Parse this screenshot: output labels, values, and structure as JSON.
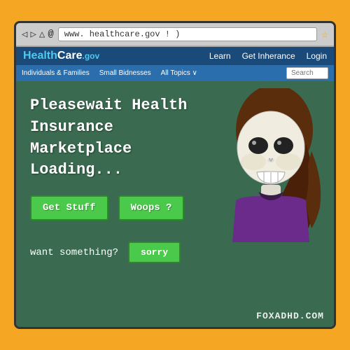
{
  "browser": {
    "address": "www. healthcare.gov ! )",
    "nav_back": "◁",
    "nav_forward": "▷",
    "nav_up": "△",
    "nav_refresh": "@",
    "bookmark": "☆"
  },
  "site": {
    "logo_health": "Health",
    "logo_care": "Care",
    "logo_gov": ".gov",
    "nav_items": [
      "Learn",
      "Get Inherance",
      "Login"
    ],
    "sub_nav_items": [
      "Individuals & Families",
      "Small Bidnesses",
      "All Topics ∨"
    ],
    "search_placeholder": "Search"
  },
  "main": {
    "loading_text": "Pleasewait Health Insurance Marketplace Loading...",
    "btn_get_stuff": "Get Stuff",
    "btn_woops": "Woops ?",
    "want_text": "want something?",
    "sorry_btn": "sorry",
    "watermark": "FOXADHD.COM"
  }
}
